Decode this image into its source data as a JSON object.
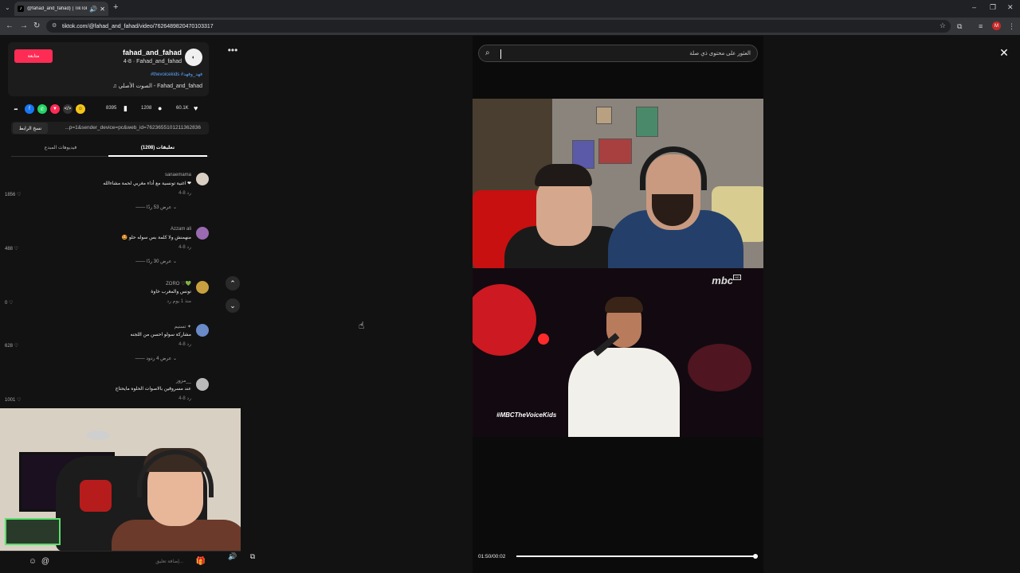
{
  "browser": {
    "tab_title": "@fahad_and_fahad) | TikTok",
    "url": "tiktok.com/@fahad_and_fahad/video/7626489820470103317",
    "profile_letter": "M"
  },
  "author": {
    "follow_label": "متابعة",
    "name": "fahad_and_fahad",
    "sub": "4-8 · Fahad_and_fahad",
    "hashtags": "#thevoicekids #فهد_وفهد",
    "music": "♫ الصوت الأصلي - Fahad_and_fahad"
  },
  "stats": {
    "likes": "60.1K",
    "comments": "1208",
    "saves": "8395"
  },
  "link": {
    "copy_label": "نسخ الرابط",
    "text": "...p=1&sender_device=pc&web_id=7623655101211362836"
  },
  "tabs": {
    "comments": "تعليقات (1208)",
    "creator_videos": "فيديوهات المبدع"
  },
  "comments": [
    {
      "user": "sanaemama",
      "text": "اغنية تونسية مع أداء مغربي لحمة مشاءالله ❤",
      "meta": "4-8   رد",
      "likes": "1856 ♡",
      "replies": "—— عرض 53 ردًا ⌄",
      "avatar_color": "#d9cfc2"
    },
    {
      "user": "Azzam ali",
      "text": "🤩 منهمنش ولا كلمة بس سوله حلو",
      "meta": "4-8   رد",
      "likes": "488 ♡",
      "replies": "—— عرض 30 ردًا ⌄",
      "avatar_color": "#9a6ab0"
    },
    {
      "user": "ZORO ♡💚",
      "text": "تونس والمغرب خاوة",
      "meta": "منذ 1 يوم   رد",
      "likes": "0 ♡",
      "replies": "",
      "avatar_color": "#c8a040"
    },
    {
      "user": "تسنيم ✦",
      "text": "مشاركة سولو احسن من اللجنه",
      "meta": "4-8   رد",
      "likes": "628 ♡",
      "replies": "—— عرض 4 ردود ⌄",
      "avatar_color": "#6a8ac8"
    },
    {
      "user": "مزوز__",
      "text": "عند مسروقين بالاصوات الحلوه مايحتاج",
      "meta": "4-8   رد",
      "likes": "1001 ♡",
      "replies": "",
      "avatar_color": "#bbbbbb"
    }
  ],
  "composer": {
    "placeholder": "إضافة تعليق..."
  },
  "player": {
    "search_placeholder": "العثور على محتوى ذي صلة",
    "channel_logo": "mbc",
    "hashtag": "#MBCTheVoiceKids",
    "time": "01:50/00:02",
    "progress": 0.99
  }
}
